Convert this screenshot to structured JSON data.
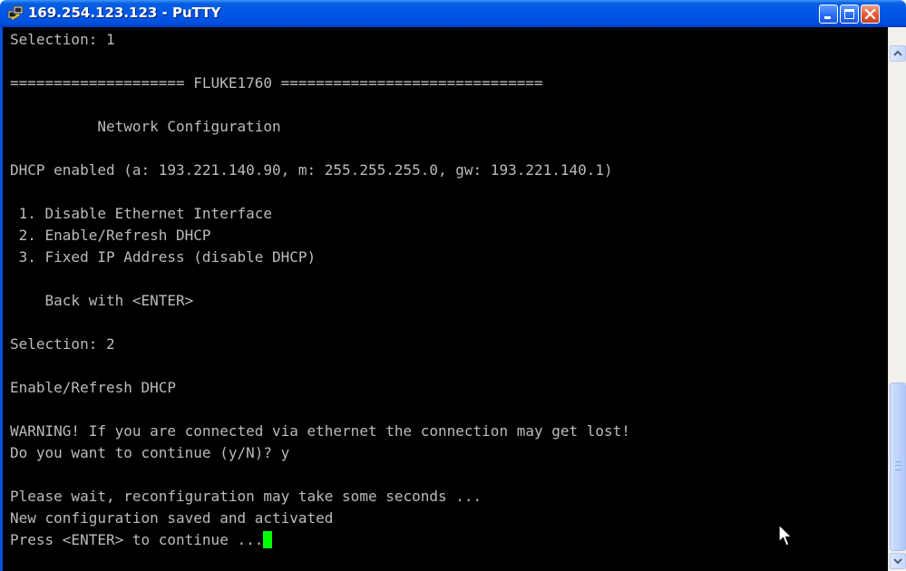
{
  "window": {
    "title": "169.254.123.123 - PuTTY",
    "icon": "putty-icon",
    "buttons": {
      "minimize": "minimize-icon",
      "maximize": "maximize-icon",
      "close": "close-icon"
    }
  },
  "terminal": {
    "lines": [
      "Selection: 1",
      "",
      "==================== FLUKE1760 ==============================",
      "",
      "          Network Configuration",
      "",
      "DHCP enabled (a: 193.221.140.90, m: 255.255.255.0, gw: 193.221.140.1)",
      "",
      " 1. Disable Ethernet Interface",
      " 2. Enable/Refresh DHCP",
      " 3. Fixed IP Address (disable DHCP)",
      "",
      "    Back with <ENTER>",
      "",
      "Selection: 2",
      "",
      "Enable/Refresh DHCP",
      "",
      "WARNING! If you are connected via ethernet the connection may get lost!",
      "Do you want to continue (y/N)? y",
      "",
      "Please wait, reconfiguration may take some seconds ...",
      "New configuration saved and activated",
      "Press <ENTER> to continue ..."
    ],
    "colors": {
      "background": "#000000",
      "foreground": "#bbbbbb",
      "cursor": "#00ff00"
    }
  },
  "scrollbar": {
    "position": 0.95
  }
}
